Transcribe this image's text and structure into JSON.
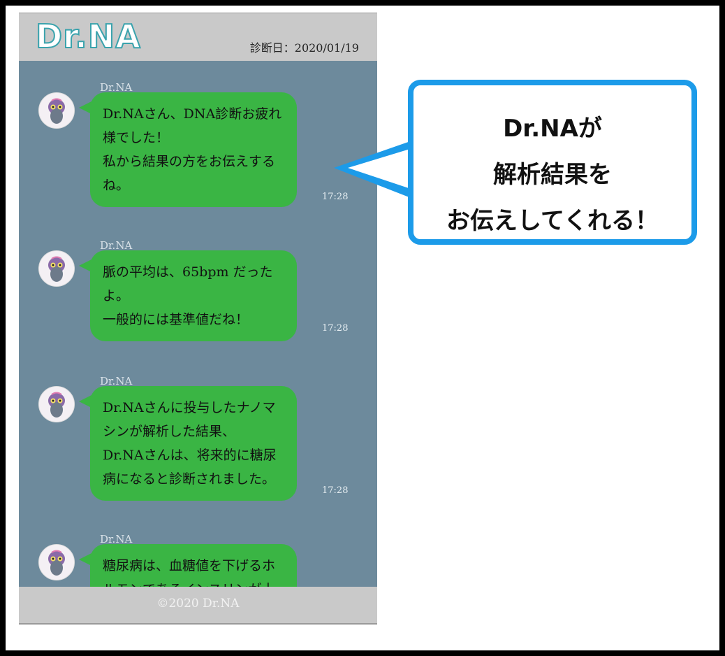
{
  "app": {
    "logo": "Dr.NA",
    "diagnosis_date": "診断日：2020/01/19",
    "footer": "©2020 Dr.NA"
  },
  "messages": [
    {
      "sender": "Dr.NA",
      "lines": [
        "Dr.NAさん、DNA診断お疲れ",
        "様でした！",
        "私から結果の方をお伝えする",
        "ね。"
      ],
      "time": "17:28"
    },
    {
      "sender": "Dr.NA",
      "lines": [
        "脈の平均は、65bpm だった",
        "よ。",
        "一般的には基準値だね！"
      ],
      "time": "17:28"
    },
    {
      "sender": "Dr.NA",
      "lines": [
        "Dr.NAさんに投与したナノマ",
        "シンが解析した結果、",
        "Dr.NAさんは、将来的に糖尿",
        "病になると診断されました。"
      ],
      "time": "17:28"
    },
    {
      "sender": "Dr.NA",
      "lines": [
        "糖尿病は、血糖値を下げるホ",
        "ルモンであるインスリンが十"
      ],
      "time": ""
    }
  ],
  "callout": {
    "lines": [
      "Dr.NAが",
      "解析結果を",
      "お伝えしてくれる！"
    ]
  },
  "colors": {
    "chat_background": "#6d8a9c",
    "bubble": "#3ab544",
    "callout_border": "#1c9be9",
    "logo_stroke": "#3aa3ad"
  }
}
